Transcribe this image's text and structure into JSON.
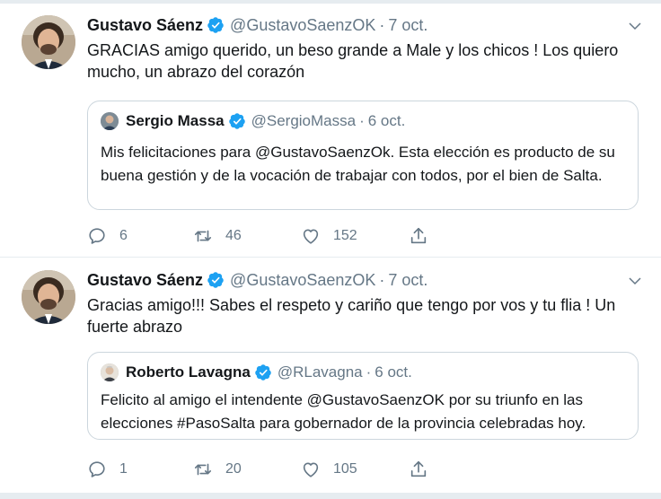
{
  "tweets": [
    {
      "author": {
        "name": "Gustavo Sáenz",
        "handle": "@GustavoSaenzOK",
        "verified": true
      },
      "separator": "·",
      "time": "7 oct.",
      "text": "GRACIAS amigo querido, un beso grande a Male y los chicos ! Los quiero mucho, un abrazo del corazón",
      "quote": {
        "author": {
          "name": "Sergio Massa",
          "handle": "@SergioMassa",
          "verified": true
        },
        "separator": "·",
        "time": "6 oct.",
        "text": "Mis felicitaciones para @GustavoSaenzOk. Esta elección es producto de su buena gestión y de la vocación de trabajar con todos, por el bien de Salta."
      },
      "actions": {
        "replies": "6",
        "retweets": "46",
        "likes": "152"
      }
    },
    {
      "author": {
        "name": "Gustavo Sáenz",
        "handle": "@GustavoSaenzOK",
        "verified": true
      },
      "separator": "·",
      "time": "7 oct.",
      "text": "Gracias amigo!!! Sabes el respeto y cariño que tengo por vos y tu flia ! Un fuerte abrazo",
      "quote": {
        "author": {
          "name": "Roberto Lavagna",
          "handle": "@RLavagna",
          "verified": true
        },
        "separator": "·",
        "time": "6 oct.",
        "text": "Felicito al amigo el intendente @GustavoSaenzOK por su triunfo en las elecciones #PasoSalta para gobernador de la provincia celebradas hoy."
      },
      "actions": {
        "replies": "1",
        "retweets": "20",
        "likes": "105"
      }
    }
  ],
  "icons": {
    "verified": "verified-badge-icon",
    "caret": "chevron-down-icon",
    "reply": "reply-icon",
    "retweet": "retweet-icon",
    "like": "heart-icon",
    "share": "share-icon"
  },
  "colors": {
    "accent": "#1da1f2",
    "secondary_text": "#657786",
    "border": "#e6ecf0",
    "quote_border": "#ccd6dd"
  }
}
